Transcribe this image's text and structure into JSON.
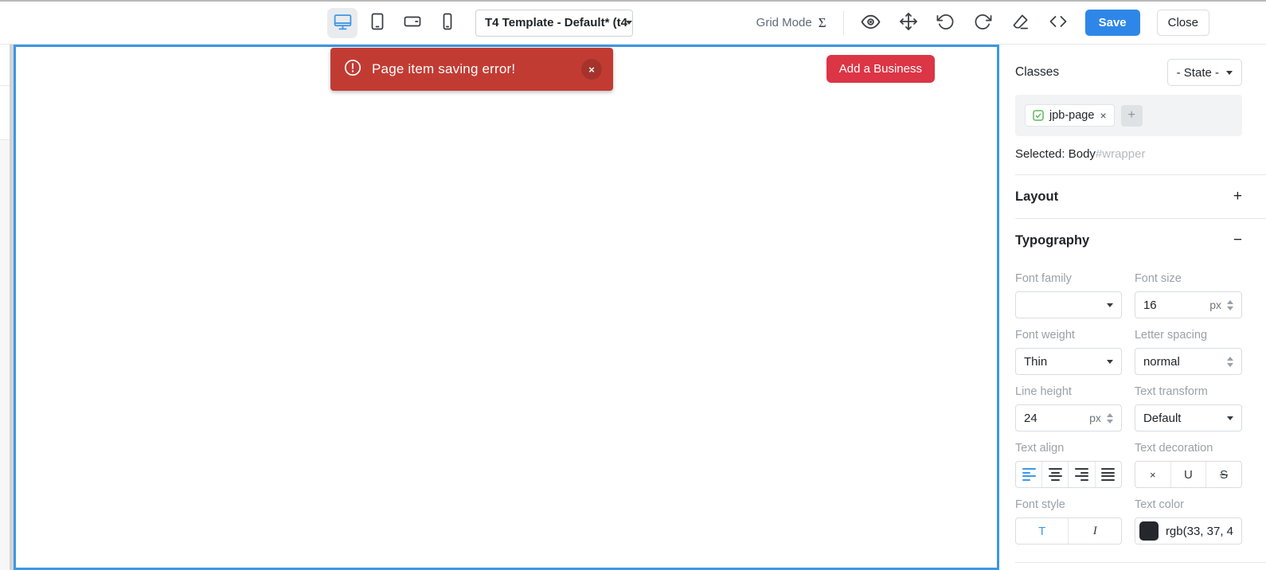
{
  "toolbar": {
    "template_select_value": "T4 Template - Default* (t4",
    "grid_mode_label": "Grid Mode",
    "grid_mode_glyph": "Σ",
    "save_label": "Save",
    "close_label": "Close"
  },
  "canvas": {
    "toast_message": "Page item saving error!",
    "toast_close": "×",
    "add_business_label": "Add a Business"
  },
  "sidebar": {
    "classes_title": "Classes",
    "state_dropdown_value": "- State -",
    "class_chip_label": "jpb-page",
    "chip_remove": "×",
    "add_class_label": "+",
    "selected_label": "Selected:",
    "selected_element": "Body",
    "selected_id": "#wrapper",
    "layout_title": "Layout",
    "layout_toggle": "+",
    "typography_title": "Typography",
    "typography_toggle": "−",
    "typography": {
      "font_family_label": "Font family",
      "font_family_value": "",
      "font_size_label": "Font size",
      "font_size_value": "16",
      "font_size_unit": "px",
      "font_weight_label": "Font weight",
      "font_weight_value": "Thin",
      "letter_spacing_label": "Letter spacing",
      "letter_spacing_value": "normal",
      "line_height_label": "Line height",
      "line_height_value": "24",
      "line_height_unit": "px",
      "text_transform_label": "Text transform",
      "text_transform_value": "Default",
      "text_align_label": "Text align",
      "text_decoration_label": "Text decoration",
      "text_decoration_options": [
        "×",
        "U",
        "S"
      ],
      "font_style_label": "Font style",
      "font_style_options": [
        "T",
        "I"
      ],
      "text_color_label": "Text color",
      "text_color_value": "rgb(33, 37, 4",
      "text_color_swatch": "#212529"
    }
  },
  "colors": {
    "accent_blue": "#2e87e8",
    "canvas_border_blue": "#3b97e3",
    "toast_red": "#c23b33",
    "add_business_red": "#dc3545"
  }
}
